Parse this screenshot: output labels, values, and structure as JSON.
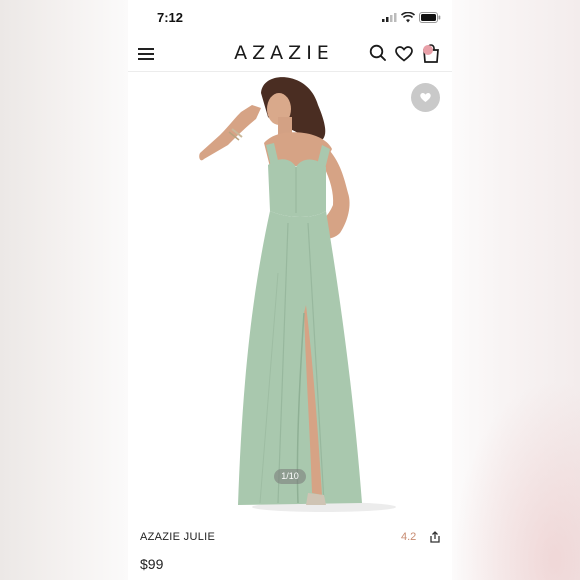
{
  "status_bar": {
    "time": "7:12"
  },
  "header": {
    "logo": "AZAZIE"
  },
  "gallery": {
    "counter": "1/10"
  },
  "product": {
    "name": "AZAZIE JULIE",
    "rating": "4.2",
    "price": "$99"
  },
  "icons": {
    "menu": "hamburger-icon",
    "search": "search-icon",
    "wishlist": "heart-icon",
    "cart": "shopping-bag-icon",
    "favorite": "heart-icon",
    "share": "share-icon"
  },
  "colors": {
    "dress": "#a9c8ae",
    "rating": "#c78a70",
    "cart_badge": "#e8a0a8"
  }
}
